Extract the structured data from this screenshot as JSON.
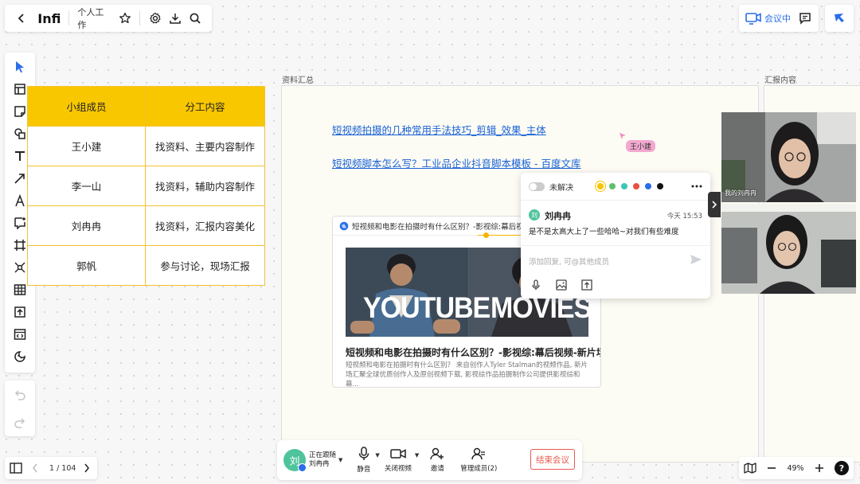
{
  "topbar": {
    "title": "Infi",
    "workspace": "个人工作"
  },
  "meeting": {
    "status_label": "会议中"
  },
  "table": {
    "headers": [
      "小组成员",
      "分工内容"
    ],
    "rows": [
      [
        "王小建",
        "找资料、主要内容制作"
      ],
      [
        "李一山",
        "找资料，辅助内容制作"
      ],
      [
        "刘冉冉",
        "找资料，汇报内容美化"
      ],
      [
        "郭帆",
        "参与讨论，现场汇报"
      ]
    ]
  },
  "frames": {
    "ziliao": "资料汇总",
    "huibao": "汇报内容"
  },
  "links": [
    "短视频拍摄的几种常用手法技巧_剪辑_效果_主体",
    "短视频脚本怎么写？工业品企业抖音脚本模板 - 百度文库"
  ],
  "cursor_user": "王小建",
  "video_card": {
    "bar_title": "短视频和电影在拍摄时有什么区别？-影视综:幕后视频-新",
    "thumb_left_text": "YOUTUBE",
    "thumb_right_text": "MOVIES",
    "title": "短视频和电影在拍摄时有什么区别？-影视综:幕后视频-新片场",
    "desc": "短视频和电影在拍摄时有什么区别？ 来自创作人Tyler Stalman的视频作品, 新片场汇聚全球优质创作人及原创视频下载, 影视综作品拍摄制作公司提供影视综和幕..."
  },
  "comment": {
    "unresolved_label": "未解决",
    "colors": [
      "#f5c400",
      "#5dbf6c",
      "#3dc4b6",
      "#e8503f",
      "#2a6ee8",
      "#111111"
    ],
    "avatar_char": "刘",
    "author": "刘冉冉",
    "time": "今天 15:53",
    "text": "是不是太高大上了一些哈哈~对我们有些难度",
    "reply_placeholder": "添加回复, 可@其他成员"
  },
  "feeds": {
    "feed1_name": "我的刘冉冉"
  },
  "pagebar": {
    "page": "1 / 104"
  },
  "callbar": {
    "avatar_char": "刘",
    "following_label": "正在跟随",
    "following_name": "刘冉冉",
    "mute_label": "静音",
    "video_label": "关闭视频",
    "invite_label": "邀请",
    "manage_label": "管理成员(2)",
    "end_label": "结束会议"
  },
  "zoom": {
    "level": "49%"
  }
}
